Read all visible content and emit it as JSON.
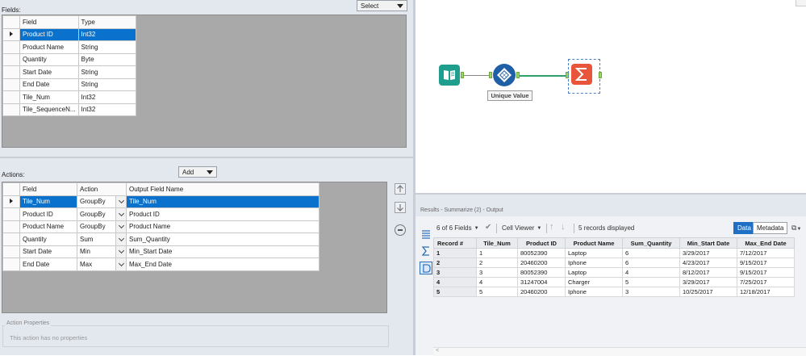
{
  "fields_panel": {
    "label": "Fields:",
    "select_dropdown": "Select",
    "columns": [
      "Field",
      "Type"
    ],
    "rows": [
      {
        "field": "Product ID",
        "type": "Int32"
      },
      {
        "field": "Product Name",
        "type": "String"
      },
      {
        "field": "Quantity",
        "type": "Byte"
      },
      {
        "field": "Start Date",
        "type": "String"
      },
      {
        "field": "End Date",
        "type": "String"
      },
      {
        "field": "Tile_Num",
        "type": "Int32"
      },
      {
        "field": "Tile_SequenceN...",
        "type": "Int32"
      }
    ]
  },
  "actions_panel": {
    "label": "Actions:",
    "add_dropdown": "Add",
    "columns": [
      "Field",
      "Action",
      "Output Field Name"
    ],
    "rows": [
      {
        "field": "Tile_Num",
        "action": "GroupBy",
        "output": "Tile_Num"
      },
      {
        "field": "Product ID",
        "action": "GroupBy",
        "output": "Product ID"
      },
      {
        "field": "Product Name",
        "action": "GroupBy",
        "output": "Product Name"
      },
      {
        "field": "Quantity",
        "action": "Sum",
        "output": "Sum_Quantity"
      },
      {
        "field": "Start Date",
        "action": "Min",
        "output": "Min_Start Date"
      },
      {
        "field": "End Date",
        "action": "Max",
        "output": "Max_End Date"
      }
    ]
  },
  "action_properties": {
    "label": "Action Properties",
    "message": "This action has no properties"
  },
  "canvas": {
    "unique_label": "Unique Value"
  },
  "results": {
    "header": "Results - Summarize (2) - Output",
    "fields_count": "6 of 6 Fields",
    "cell_viewer": "Cell Viewer",
    "records_displayed": "5 records displayed",
    "data_tab": "Data",
    "metadata_tab": "Metadata",
    "columns": [
      "Record #",
      "Tile_Num",
      "Product ID",
      "Product Name",
      "Sum_Quantity",
      "Min_Start Date",
      "Max_End Date"
    ],
    "rows": [
      {
        "rec": "1",
        "tile": "1",
        "pid": "80052390",
        "name": "Laptop",
        "qty": "6",
        "start": "3/29/2017",
        "end": "7/12/2017"
      },
      {
        "rec": "2",
        "tile": "2",
        "pid": "20460200",
        "name": "Iphone",
        "qty": "6",
        "start": "4/23/2017",
        "end": "9/15/2017"
      },
      {
        "rec": "3",
        "tile": "3",
        "pid": "80052390",
        "name": "Laptop",
        "qty": "4",
        "start": "8/12/2017",
        "end": "9/15/2017"
      },
      {
        "rec": "4",
        "tile": "4",
        "pid": "31247004",
        "name": "Charger",
        "qty": "5",
        "start": "3/29/2017",
        "end": "7/25/2017"
      },
      {
        "rec": "5",
        "tile": "5",
        "pid": "20460200",
        "name": "Iphone",
        "qty": "3",
        "start": "10/25/2017",
        "end": "12/18/2017"
      }
    ]
  },
  "colors": {
    "selection": "#0a72cc",
    "input_tool": "#1f9e8e",
    "unique_tool": "#1f5fa6",
    "summarize_tool": "#e8553a",
    "connector": "#2fa06a",
    "data_tab_active": "#1f6fc5"
  }
}
